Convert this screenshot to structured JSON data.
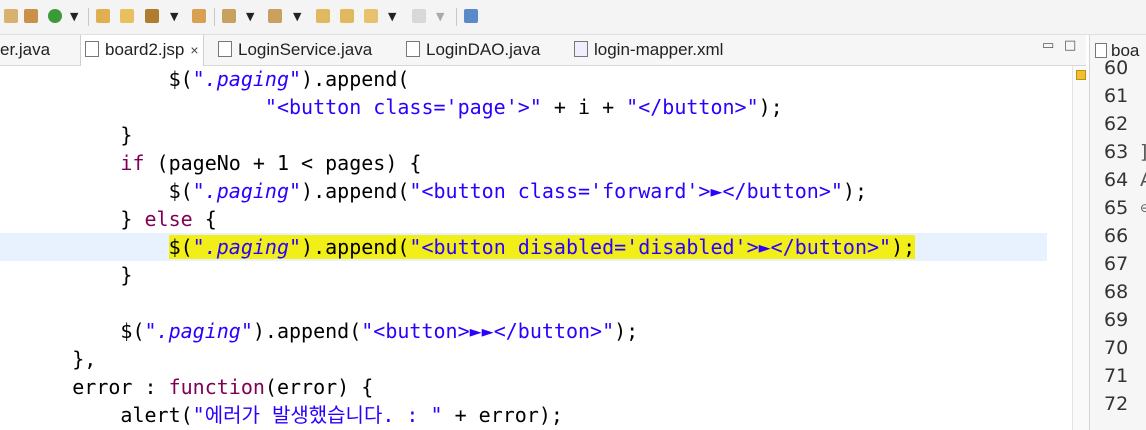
{
  "toolbar": {
    "icons": [
      "debug-icon",
      "run-config-icon",
      "run-icon",
      "open-type-icon",
      "open-folder-icon",
      "launch-icon",
      "open-task-icon",
      "next-annotation-icon",
      "prev-annotation-icon",
      "last-edit-icon",
      "forward-edit-icon",
      "back-icon",
      "forward-icon",
      "new-window-icon"
    ],
    "dropdown_glyph": "▼"
  },
  "tabs": [
    {
      "label": "er.java",
      "icon": "java-file-icon"
    },
    {
      "label": "board2.jsp",
      "icon": "jsp-file-icon",
      "active": true,
      "close": "×"
    },
    {
      "label": "LoginService.java",
      "icon": "java-file-icon"
    },
    {
      "label": "LoginDAO.java",
      "icon": "java-file-icon"
    },
    {
      "label": "login-mapper.xml",
      "icon": "xml-file-icon"
    }
  ],
  "window_controls": {
    "minimize": "▭",
    "maximize": "□"
  },
  "side_panel": {
    "tab_label": "boa",
    "line_numbers": [
      "60",
      "61",
      "62",
      "63",
      "64",
      "65",
      "66",
      "67",
      "68",
      "69",
      "70",
      "71",
      "72"
    ],
    "suffixes": {
      "63": "]",
      "64": "A",
      "65": "⊖"
    }
  },
  "code": [
    {
      "indent": "              ",
      "parts": [
        {
          "t": "$(",
          "c": ""
        },
        {
          "t": "\".paging\"",
          "c": "str"
        },
        {
          "t": ").append(",
          "c": ""
        }
      ]
    },
    {
      "indent": "                      ",
      "parts": [
        {
          "t": "\"<button class='page'>\"",
          "c": "str"
        },
        {
          "t": " + i + ",
          "c": ""
        },
        {
          "t": "\"</button>\"",
          "c": "str"
        },
        {
          "t": ");",
          "c": ""
        }
      ]
    },
    {
      "indent": "          ",
      "parts": [
        {
          "t": "}",
          "c": ""
        }
      ]
    },
    {
      "indent": "          ",
      "parts": [
        {
          "t": "if",
          "c": "kw"
        },
        {
          "t": " (pageNo + 1 < pages) {",
          "c": ""
        }
      ]
    },
    {
      "indent": "              ",
      "parts": [
        {
          "t": "$(",
          "c": ""
        },
        {
          "t": "\".paging\"",
          "c": "str"
        },
        {
          "t": ").append(",
          "c": ""
        },
        {
          "t": "\"<button class='forward'>►</button>\"",
          "c": "str"
        },
        {
          "t": ");",
          "c": ""
        }
      ]
    },
    {
      "indent": "          ",
      "parts": [
        {
          "t": "} ",
          "c": ""
        },
        {
          "t": "else",
          "c": "kw"
        },
        {
          "t": " {",
          "c": ""
        }
      ]
    },
    {
      "indent": "              ",
      "current": true,
      "highlight": true,
      "parts": [
        {
          "t": "$(",
          "c": ""
        },
        {
          "t": "\".paging\"",
          "c": "str"
        },
        {
          "t": ").append(",
          "c": ""
        },
        {
          "t": "\"<button disabled='disabled'>►</button>\"",
          "c": "str"
        },
        {
          "t": ");",
          "c": ""
        }
      ]
    },
    {
      "indent": "          ",
      "parts": [
        {
          "t": "}",
          "c": ""
        }
      ]
    },
    {
      "indent": "",
      "parts": []
    },
    {
      "indent": "          ",
      "parts": [
        {
          "t": "$(",
          "c": ""
        },
        {
          "t": "\".paging\"",
          "c": "str"
        },
        {
          "t": ").append(",
          "c": ""
        },
        {
          "t": "\"<button>►►</button>\"",
          "c": "str"
        },
        {
          "t": ");",
          "c": ""
        }
      ]
    },
    {
      "indent": "      ",
      "parts": [
        {
          "t": "},",
          "c": ""
        }
      ]
    },
    {
      "indent": "      ",
      "parts": [
        {
          "t": "error : ",
          "c": ""
        },
        {
          "t": "function",
          "c": "kw"
        },
        {
          "t": "(error) {",
          "c": ""
        }
      ]
    },
    {
      "indent": "          ",
      "parts": [
        {
          "t": "alert(",
          "c": ""
        },
        {
          "t": "\"에러가 발생했습니다. : \"",
          "c": "str"
        },
        {
          "t": " + error);",
          "c": ""
        }
      ]
    }
  ],
  "colors": {
    "keyword": "#7f0055",
    "string": "#2a00ff",
    "highlight": "#f2ee18",
    "current_line": "#e8f2fe"
  }
}
